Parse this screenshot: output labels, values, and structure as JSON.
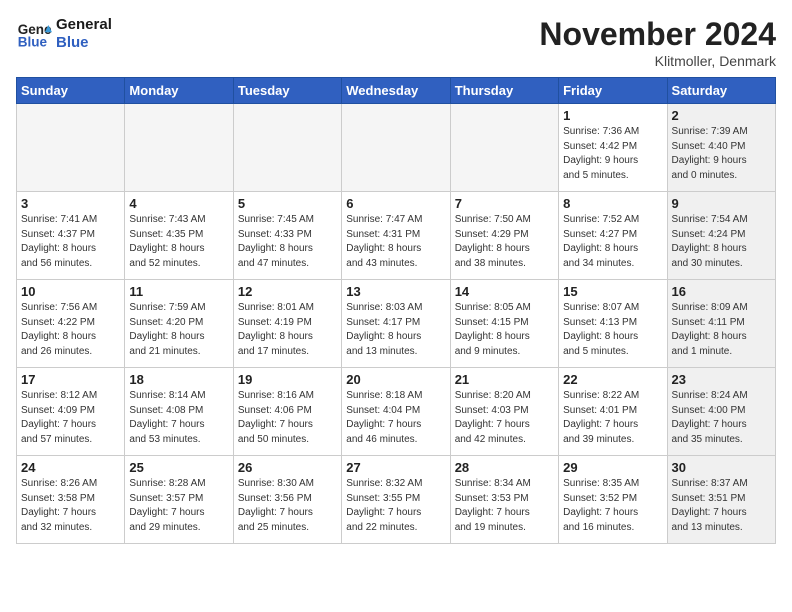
{
  "header": {
    "logo_line1": "General",
    "logo_line2": "Blue",
    "title": "November 2024",
    "location": "Klitmoller, Denmark"
  },
  "weekdays": [
    "Sunday",
    "Monday",
    "Tuesday",
    "Wednesday",
    "Thursday",
    "Friday",
    "Saturday"
  ],
  "weeks": [
    [
      {
        "day": "",
        "info": "",
        "shaded": false,
        "empty": true
      },
      {
        "day": "",
        "info": "",
        "shaded": false,
        "empty": true
      },
      {
        "day": "",
        "info": "",
        "shaded": false,
        "empty": true
      },
      {
        "day": "",
        "info": "",
        "shaded": false,
        "empty": true
      },
      {
        "day": "",
        "info": "",
        "shaded": false,
        "empty": true
      },
      {
        "day": "1",
        "info": "Sunrise: 7:36 AM\nSunset: 4:42 PM\nDaylight: 9 hours\nand 5 minutes.",
        "shaded": false,
        "empty": false
      },
      {
        "day": "2",
        "info": "Sunrise: 7:39 AM\nSunset: 4:40 PM\nDaylight: 9 hours\nand 0 minutes.",
        "shaded": true,
        "empty": false
      }
    ],
    [
      {
        "day": "3",
        "info": "Sunrise: 7:41 AM\nSunset: 4:37 PM\nDaylight: 8 hours\nand 56 minutes.",
        "shaded": false,
        "empty": false
      },
      {
        "day": "4",
        "info": "Sunrise: 7:43 AM\nSunset: 4:35 PM\nDaylight: 8 hours\nand 52 minutes.",
        "shaded": false,
        "empty": false
      },
      {
        "day": "5",
        "info": "Sunrise: 7:45 AM\nSunset: 4:33 PM\nDaylight: 8 hours\nand 47 minutes.",
        "shaded": false,
        "empty": false
      },
      {
        "day": "6",
        "info": "Sunrise: 7:47 AM\nSunset: 4:31 PM\nDaylight: 8 hours\nand 43 minutes.",
        "shaded": false,
        "empty": false
      },
      {
        "day": "7",
        "info": "Sunrise: 7:50 AM\nSunset: 4:29 PM\nDaylight: 8 hours\nand 38 minutes.",
        "shaded": false,
        "empty": false
      },
      {
        "day": "8",
        "info": "Sunrise: 7:52 AM\nSunset: 4:27 PM\nDaylight: 8 hours\nand 34 minutes.",
        "shaded": false,
        "empty": false
      },
      {
        "day": "9",
        "info": "Sunrise: 7:54 AM\nSunset: 4:24 PM\nDaylight: 8 hours\nand 30 minutes.",
        "shaded": true,
        "empty": false
      }
    ],
    [
      {
        "day": "10",
        "info": "Sunrise: 7:56 AM\nSunset: 4:22 PM\nDaylight: 8 hours\nand 26 minutes.",
        "shaded": false,
        "empty": false
      },
      {
        "day": "11",
        "info": "Sunrise: 7:59 AM\nSunset: 4:20 PM\nDaylight: 8 hours\nand 21 minutes.",
        "shaded": false,
        "empty": false
      },
      {
        "day": "12",
        "info": "Sunrise: 8:01 AM\nSunset: 4:19 PM\nDaylight: 8 hours\nand 17 minutes.",
        "shaded": false,
        "empty": false
      },
      {
        "day": "13",
        "info": "Sunrise: 8:03 AM\nSunset: 4:17 PM\nDaylight: 8 hours\nand 13 minutes.",
        "shaded": false,
        "empty": false
      },
      {
        "day": "14",
        "info": "Sunrise: 8:05 AM\nSunset: 4:15 PM\nDaylight: 8 hours\nand 9 minutes.",
        "shaded": false,
        "empty": false
      },
      {
        "day": "15",
        "info": "Sunrise: 8:07 AM\nSunset: 4:13 PM\nDaylight: 8 hours\nand 5 minutes.",
        "shaded": false,
        "empty": false
      },
      {
        "day": "16",
        "info": "Sunrise: 8:09 AM\nSunset: 4:11 PM\nDaylight: 8 hours\nand 1 minute.",
        "shaded": true,
        "empty": false
      }
    ],
    [
      {
        "day": "17",
        "info": "Sunrise: 8:12 AM\nSunset: 4:09 PM\nDaylight: 7 hours\nand 57 minutes.",
        "shaded": false,
        "empty": false
      },
      {
        "day": "18",
        "info": "Sunrise: 8:14 AM\nSunset: 4:08 PM\nDaylight: 7 hours\nand 53 minutes.",
        "shaded": false,
        "empty": false
      },
      {
        "day": "19",
        "info": "Sunrise: 8:16 AM\nSunset: 4:06 PM\nDaylight: 7 hours\nand 50 minutes.",
        "shaded": false,
        "empty": false
      },
      {
        "day": "20",
        "info": "Sunrise: 8:18 AM\nSunset: 4:04 PM\nDaylight: 7 hours\nand 46 minutes.",
        "shaded": false,
        "empty": false
      },
      {
        "day": "21",
        "info": "Sunrise: 8:20 AM\nSunset: 4:03 PM\nDaylight: 7 hours\nand 42 minutes.",
        "shaded": false,
        "empty": false
      },
      {
        "day": "22",
        "info": "Sunrise: 8:22 AM\nSunset: 4:01 PM\nDaylight: 7 hours\nand 39 minutes.",
        "shaded": false,
        "empty": false
      },
      {
        "day": "23",
        "info": "Sunrise: 8:24 AM\nSunset: 4:00 PM\nDaylight: 7 hours\nand 35 minutes.",
        "shaded": true,
        "empty": false
      }
    ],
    [
      {
        "day": "24",
        "info": "Sunrise: 8:26 AM\nSunset: 3:58 PM\nDaylight: 7 hours\nand 32 minutes.",
        "shaded": false,
        "empty": false
      },
      {
        "day": "25",
        "info": "Sunrise: 8:28 AM\nSunset: 3:57 PM\nDaylight: 7 hours\nand 29 minutes.",
        "shaded": false,
        "empty": false
      },
      {
        "day": "26",
        "info": "Sunrise: 8:30 AM\nSunset: 3:56 PM\nDaylight: 7 hours\nand 25 minutes.",
        "shaded": false,
        "empty": false
      },
      {
        "day": "27",
        "info": "Sunrise: 8:32 AM\nSunset: 3:55 PM\nDaylight: 7 hours\nand 22 minutes.",
        "shaded": false,
        "empty": false
      },
      {
        "day": "28",
        "info": "Sunrise: 8:34 AM\nSunset: 3:53 PM\nDaylight: 7 hours\nand 19 minutes.",
        "shaded": false,
        "empty": false
      },
      {
        "day": "29",
        "info": "Sunrise: 8:35 AM\nSunset: 3:52 PM\nDaylight: 7 hours\nand 16 minutes.",
        "shaded": false,
        "empty": false
      },
      {
        "day": "30",
        "info": "Sunrise: 8:37 AM\nSunset: 3:51 PM\nDaylight: 7 hours\nand 13 minutes.",
        "shaded": true,
        "empty": false
      }
    ]
  ]
}
